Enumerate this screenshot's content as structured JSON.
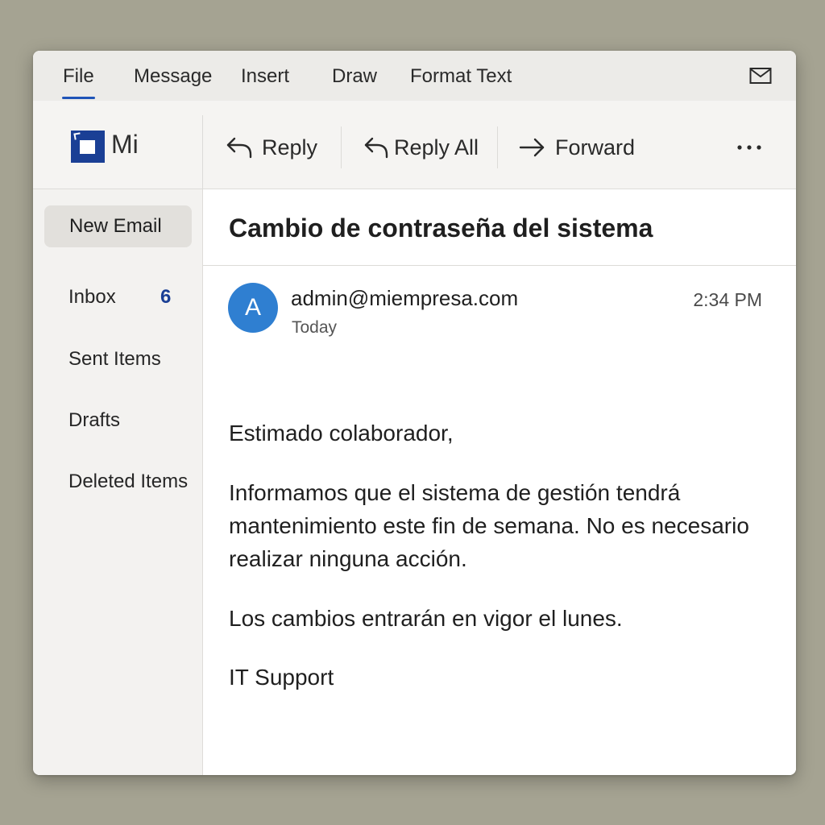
{
  "menubar": {
    "items": [
      "File",
      "Message",
      "Insert",
      "Draw",
      "Format Text"
    ],
    "active": "File",
    "right_icon": "mail-icon"
  },
  "brand": {
    "text": "Mi"
  },
  "toolbar": {
    "reply_label": "Reply",
    "reply_all_label": "Reply All",
    "forward_label": "Forward",
    "more_icon": "more-horizontal-icon"
  },
  "sidebar": {
    "new_email_label": "New Email",
    "items": [
      {
        "label": "Inbox",
        "count": "6"
      },
      {
        "label": "Sent Items"
      },
      {
        "label": "Drafts"
      },
      {
        "label": "Deleted Items"
      }
    ]
  },
  "message": {
    "subject": "Cambio de contraseña del sistema",
    "avatar_letter": "A",
    "sender": "admin@miempresa.com",
    "date": "Today",
    "time": "2:34 PM",
    "greeting": "Estimado colaborador,",
    "paragraph1_lines": [
      "Informamos que el sistema de gestión tendrá",
      "mantenimiento este fin de semana. No es necesario",
      "realizar ninguna acción."
    ],
    "paragraph2": "Los cambios entrarán en vigor el lunes.",
    "signature": "IT Support"
  },
  "colors": {
    "accent": "#1f54b8",
    "brand_blue": "#1a3f95",
    "avatar": "#2f7fd1",
    "background": "#a5a392"
  }
}
